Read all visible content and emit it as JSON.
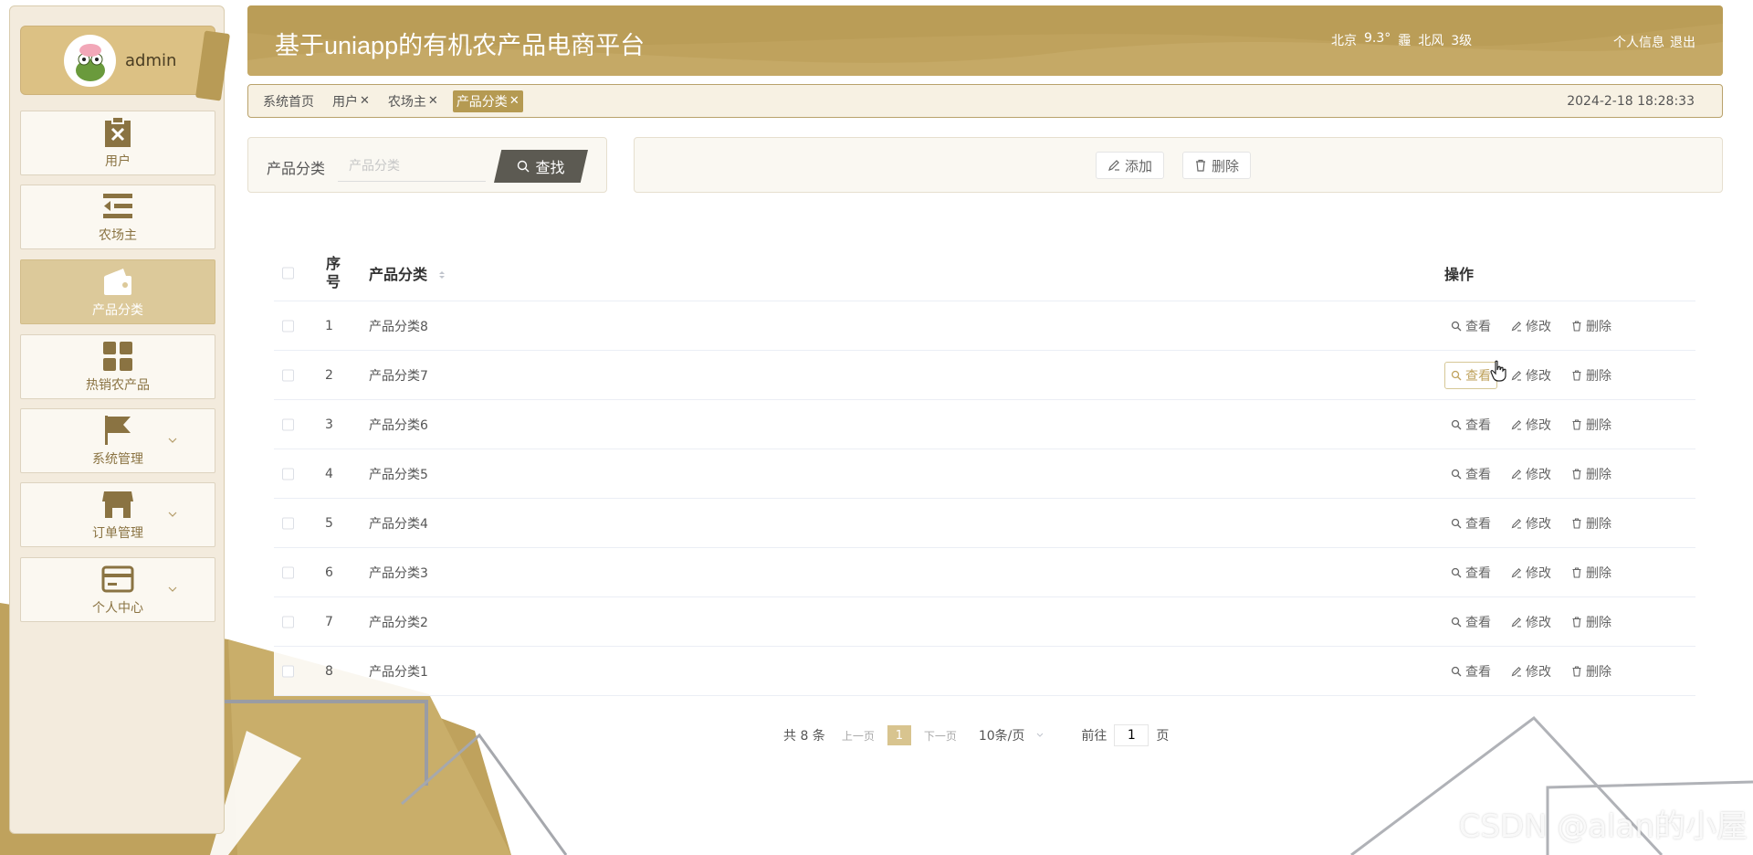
{
  "app": {
    "title": "基于uniapp的有机农产品电商平台",
    "weather": {
      "city": "北京",
      "temp": "9.3°",
      "condition": "霾",
      "wind": "北风",
      "level": "3级"
    },
    "links": {
      "profile": "个人信息",
      "logout": "退出"
    }
  },
  "user": {
    "name": "admin"
  },
  "sidebar": {
    "items": [
      {
        "label": "用户",
        "icon": "clipboard-x-icon"
      },
      {
        "label": "农场主",
        "icon": "list-indent-icon"
      },
      {
        "label": "产品分类",
        "icon": "wallet-icon",
        "active": true
      },
      {
        "label": "热销农产品",
        "icon": "grid-icon"
      },
      {
        "label": "系统管理",
        "icon": "flag-icon",
        "expandable": true
      },
      {
        "label": "订单管理",
        "icon": "store-icon",
        "expandable": true
      },
      {
        "label": "个人中心",
        "icon": "card-icon",
        "expandable": true
      }
    ]
  },
  "tags": {
    "items": [
      {
        "label": "系统首页",
        "closable": false
      },
      {
        "label": "用户",
        "closable": true
      },
      {
        "label": "农场主",
        "closable": true
      },
      {
        "label": "产品分类",
        "closable": true,
        "active": true
      }
    ],
    "datetime": "2024-2-18 18:28:33"
  },
  "search": {
    "label": "产品分类",
    "placeholder": "产品分类",
    "button": "查找"
  },
  "actions": {
    "add": "添加",
    "delete": "删除"
  },
  "table": {
    "headers": {
      "index_line1": "序",
      "index_line2": "号",
      "name": "产品分类",
      "ops": "操作"
    },
    "ops": {
      "view": "查看",
      "edit": "修改",
      "delete": "删除"
    },
    "rows": [
      {
        "index": "1",
        "name": "产品分类8"
      },
      {
        "index": "2",
        "name": "产品分类7"
      },
      {
        "index": "3",
        "name": "产品分类6"
      },
      {
        "index": "4",
        "name": "产品分类5"
      },
      {
        "index": "5",
        "name": "产品分类4"
      },
      {
        "index": "6",
        "name": "产品分类3"
      },
      {
        "index": "7",
        "name": "产品分类2"
      },
      {
        "index": "8",
        "name": "产品分类1"
      }
    ],
    "hovered_row": 1
  },
  "pagination": {
    "total": "共 8 条",
    "prev": "上一页",
    "page": "1",
    "next": "下一页",
    "size": "10条/页",
    "goto_prefix": "前往",
    "goto_value": "1",
    "goto_suffix": "页"
  },
  "watermark": "CSDN @alan的小屋",
  "colors": {
    "accent": "#bfa25d",
    "sidebar_bg": "#f3ebdd",
    "active_nav": "#dcc99a"
  }
}
